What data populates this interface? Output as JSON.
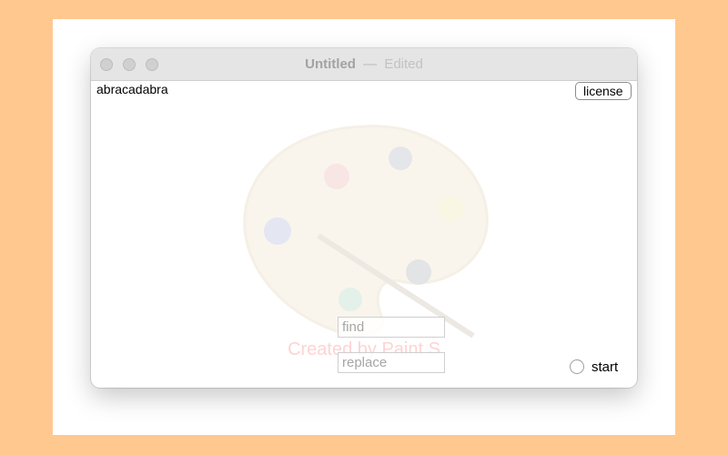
{
  "window": {
    "title": "Untitled",
    "separator": "—",
    "status": "Edited"
  },
  "editor": {
    "text": "abracadabra",
    "watermark": "Created by Paint S"
  },
  "buttons": {
    "license": "license"
  },
  "inputs": {
    "find_placeholder": "find",
    "replace_placeholder": "replace"
  },
  "controls": {
    "start_label": "start"
  },
  "colors": {
    "background": "#FFC88F",
    "watermark": "#FFD3D3"
  }
}
